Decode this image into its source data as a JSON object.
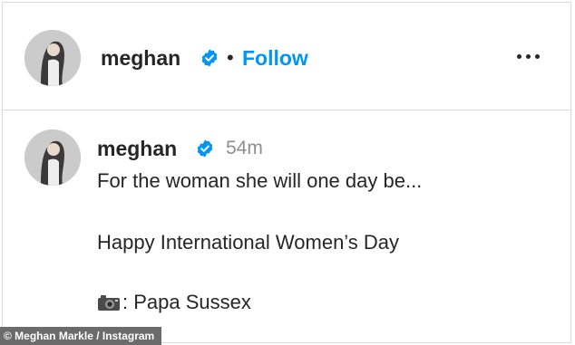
{
  "post_header": {
    "username": "meghan",
    "verified_icon": "verified-badge-icon",
    "separator": "•",
    "follow_label": "Follow",
    "more_icon": "more-options-icon"
  },
  "comment": {
    "username": "meghan",
    "verified_icon": "verified-badge-icon",
    "timestamp": "54m",
    "line1": "For the woman she will one day be...",
    "line2": "Happy International Women’s Day",
    "camera_icon": "camera-emoji-icon",
    "line3": ": Papa Sussex"
  },
  "credit": "© Meghan Markle / Instagram",
  "colors": {
    "follow": "#0095f6",
    "verified": "#0095f6",
    "timestamp": "#8e8e8e",
    "credit_bg": "#6b6b6b"
  }
}
